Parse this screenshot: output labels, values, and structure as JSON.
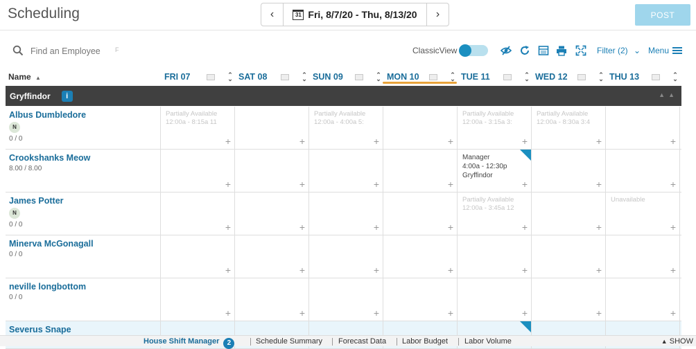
{
  "app": {
    "title": "Scheduling"
  },
  "datenav": {
    "range": "Fri, 8/7/20 - Thu, 8/13/20",
    "calendar_day": "31",
    "prev": "‹",
    "next": "›"
  },
  "post": {
    "label": "POST"
  },
  "toolbar": {
    "search_placeholder": "Find an Employee",
    "f_mark": "F",
    "classic_view": "ClassicView",
    "filter": "Filter (2)",
    "menu": "Menu"
  },
  "columns": {
    "name": "Name",
    "days": [
      "FRI 07",
      "SAT 08",
      "SUN 09",
      "MON 10",
      "TUE 11",
      "WED 12",
      "THU 13"
    ],
    "active_day_index": 3
  },
  "group": {
    "name": "Gryffindor",
    "info": "i"
  },
  "employees": [
    {
      "name": "Albus Dumbledore",
      "badge": "N",
      "hours": "0 / 0",
      "cells": [
        {
          "avail": [
            "Partially Available",
            "12:00a - 8:15a   11"
          ]
        },
        {},
        {
          "avail": [
            "Partially Available",
            "12:00a - 4:00a   5:"
          ]
        },
        {},
        {
          "avail": [
            "Partially Available",
            "12:00a - 3:15a   3:"
          ]
        },
        {
          "avail": [
            "Partially Available",
            "12:00a - 8:30a   3:4"
          ]
        },
        {}
      ]
    },
    {
      "name": "Crookshanks Meow",
      "badge": "",
      "hours": "8.00 / 8.00",
      "cells": [
        {},
        {},
        {},
        {},
        {
          "shift": {
            "role": "Manager",
            "time": "4:00a - 12:30p",
            "group": "Gryffindor"
          }
        },
        {},
        {}
      ]
    },
    {
      "name": "James Potter",
      "badge": "N",
      "hours": "0 / 0",
      "cells": [
        {},
        {},
        {},
        {},
        {
          "avail": [
            "Partially Available",
            "12:00a - 3:45a   12"
          ]
        },
        {},
        {
          "avail": [
            "Unavailable"
          ]
        }
      ]
    },
    {
      "name": "Minerva McGonagall",
      "badge": "",
      "hours": "0 / 0",
      "cells": [
        {},
        {},
        {},
        {},
        {},
        {},
        {}
      ]
    },
    {
      "name": "neville longbottom",
      "badge": "",
      "hours": "0 / 0",
      "cells": [
        {},
        {},
        {},
        {},
        {},
        {},
        {}
      ]
    },
    {
      "name": "Severus Snape",
      "badge": "",
      "hours": "",
      "cells": [
        {},
        {},
        {},
        {},
        {
          "shift": {
            "role": "",
            "time": "",
            "group": ""
          }
        },
        {},
        {}
      ]
    }
  ],
  "cell_add": "+",
  "bottom": {
    "tabs": [
      "House Shift Manager",
      "Schedule Summary",
      "Forecast Data",
      "Labor Budget",
      "Labor Volume"
    ],
    "badge": "2",
    "show": "SHOW"
  },
  "colors": {
    "accent": "#1b7fb5",
    "group_bar": "#404040",
    "active_underline": "#e8a33a",
    "post_button": "#9fd6ec"
  }
}
